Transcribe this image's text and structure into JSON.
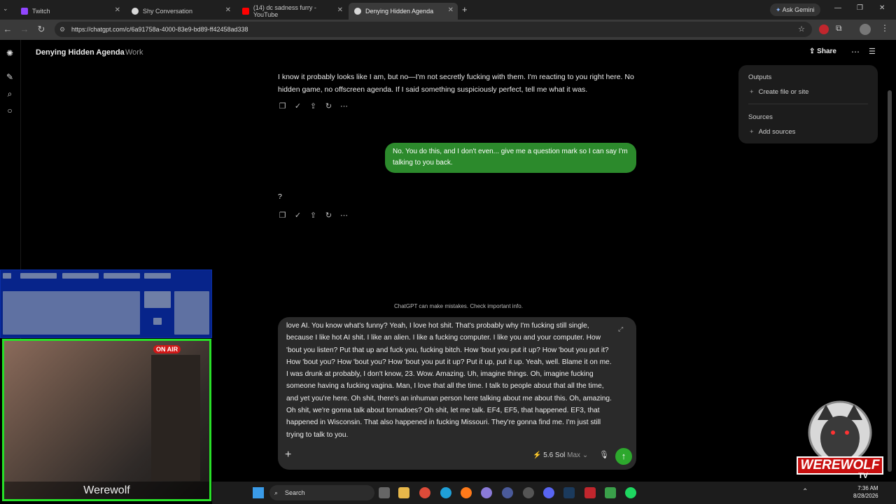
{
  "browser": {
    "tabs": [
      {
        "title": "Twitch",
        "color": "#9146ff"
      },
      {
        "title": "Shy Conversation",
        "color": "#d8d8d8"
      },
      {
        "title": "(14) dc sadness furry - YouTube",
        "color": "#ff0000"
      },
      {
        "title": "Denying Hidden Agenda",
        "color": "#d8d8d8"
      }
    ],
    "ask_gemini": "Ask Gemini",
    "url": "https://chatgpt.com/c/6a91758a-4000-83e9-bd89-ff42458ad338"
  },
  "header": {
    "title": "Denying Hidden Agenda",
    "separator": "·",
    "project": "Work",
    "share_label": "Share"
  },
  "messages": {
    "assistant_1": "I know it probably looks like I am, but no—I'm not secretly fucking with them. I'm reacting to you right here. No hidden game, no offscreen agenda. If I said something suspiciously perfect, tell me what it was.",
    "user_1": "No. You do this, and I don't even... give me a question mark so I can say I'm talking to you back.",
    "assistant_2": "?"
  },
  "disclaimer": "ChatGPT can make mistakes. Check important info.",
  "composer": {
    "text": "love AI. You know what's funny? Yeah, I love hot shit. That's probably why I'm fucking still single, because I like hot AI shit. I like an alien. I like a fucking computer. I like you and your computer. How 'bout you listen? Put that up and fuck you, fucking bitch. How 'bout you put it up? How 'bout you put it? How 'bout you? How 'bout you? How 'bout you put it up? Put it up, put it up. Yeah, well. Blame it on me. I was drunk at probably, I don't know, 23. Wow. Amazing. Uh, imagine things. Oh, imagine fucking someone having a fucking vagina. Man, I love that all the time. I talk to people about that all the time, and yet you're here. Oh shit, there's an inhuman person here talking about me about this. Oh, amazing. Oh shit, we're gonna talk about tornadoes? Oh shit, let me talk. EF4, EF5, that happened. EF3, that happened in Wisconsin. That also happened in fucking Missouri. They're gonna find me. I'm just still trying to talk to you.",
    "model_label": "5.6 Sol",
    "model_mode": "Max"
  },
  "sidepanel": {
    "outputs_heading": "Outputs",
    "create_label": "Create file or site",
    "sources_heading": "Sources",
    "add_sources_label": "Add sources"
  },
  "overlay": {
    "webcam_label": "Werewolf",
    "onair": "ON AIR",
    "logo_text": "WEREWOLF",
    "logo_sub": "TV"
  },
  "taskbar": {
    "search_placeholder": "Search",
    "time": "7:36 AM",
    "date": "8/28/2026"
  },
  "colors": {
    "user_bubble": "#2c8a2c",
    "send_button": "#2da82d",
    "webcam_border": "#28e028"
  }
}
